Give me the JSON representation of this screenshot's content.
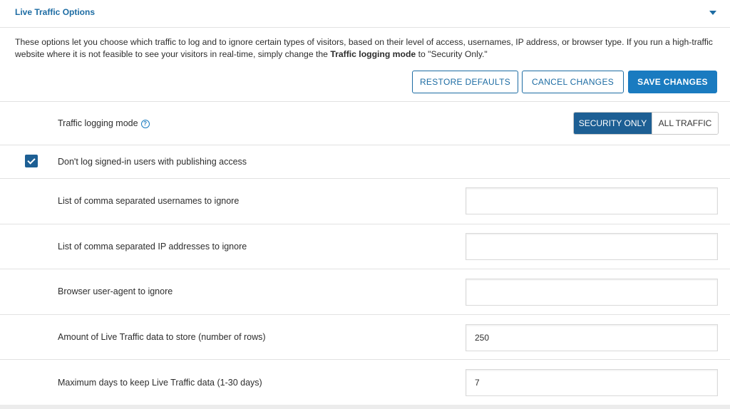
{
  "header": {
    "title": "Live Traffic Options"
  },
  "description": {
    "part1": "These options let you choose which traffic to log and to ignore certain types of visitors, based on their level of access, usernames, IP address, or browser type. If you run a high-traffic website where it is not feasible to see your visitors in real-time, simply change the ",
    "bold": "Traffic logging mode",
    "part2": " to \"Security Only.\""
  },
  "actions": {
    "restore": "RESTORE DEFAULTS",
    "cancel": "CANCEL CHANGES",
    "save": "SAVE CHANGES"
  },
  "logging_mode": {
    "label": "Traffic logging mode",
    "help_icon": "?",
    "options": [
      "SECURITY ONLY",
      "ALL TRAFFIC"
    ],
    "selected": "SECURITY ONLY"
  },
  "signed_in": {
    "label": "Don't log signed-in users with publishing access",
    "checked": true
  },
  "fields": {
    "usernames": {
      "label": "List of comma separated usernames to ignore",
      "value": ""
    },
    "ips": {
      "label": "List of comma separated IP addresses to ignore",
      "value": ""
    },
    "user_agent": {
      "label": "Browser user-agent to ignore",
      "value": ""
    },
    "rows": {
      "label": "Amount of Live Traffic data to store (number of rows)",
      "value": "250"
    },
    "days": {
      "label": "Maximum days to keep Live Traffic data (1-30 days)",
      "value": "7"
    }
  },
  "colors": {
    "accent": "#1a7bc0",
    "dark_accent": "#1d5f94",
    "title": "#1d6ca3"
  }
}
